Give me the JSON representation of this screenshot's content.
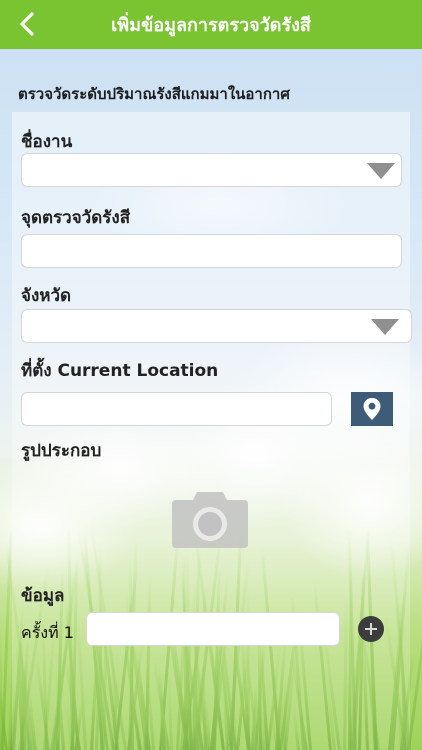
{
  "header": {
    "title": "เพิ่มข้อมูลการตรวจวัดรังสี",
    "back_icon": "chevron-left-icon"
  },
  "section": {
    "title": "ตรวจวัดระดับปริมาณรังสีแกมมาในอากาศ"
  },
  "form": {
    "event_name": {
      "label": "ชื่องาน",
      "value": ""
    },
    "checkpoint": {
      "label": "จุดตรวจวัดรังสี",
      "value": ""
    },
    "province": {
      "label": "จังหวัด",
      "value": ""
    },
    "location": {
      "label": "ที่ตั้ง Current Location",
      "value": "",
      "button_icon": "map-pin-icon"
    },
    "photo": {
      "label": "รูปประกอบ",
      "icon": "camera-icon"
    },
    "data": {
      "label": "ข้อมูล",
      "entry_label": "ครั้งที่ 1",
      "entry_value": "",
      "add_icon": "plus-circle-icon"
    }
  },
  "colors": {
    "header_bg": "#7ac331",
    "location_button": "#3e5b78"
  }
}
